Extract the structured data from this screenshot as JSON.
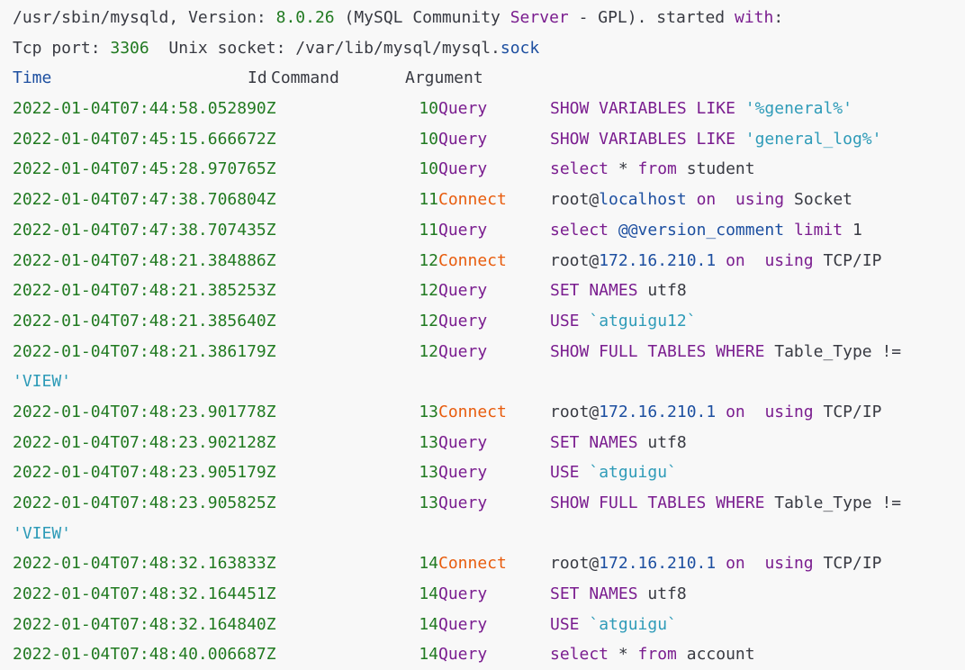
{
  "header": {
    "line1": {
      "a": "/usr/sbin/mysqld, Version: ",
      "version": "8.0.26",
      "b": " (MySQL Community ",
      "server": "Server",
      "c": " - GPL). started ",
      "with": "with",
      "d": ":"
    },
    "line2": {
      "a": "Tcp port: ",
      "port": "3306",
      "b": "  Unix socket: /var/lib/mysql/mysql.",
      "sock": "sock"
    },
    "columns": {
      "time": "Time",
      "id": "Id",
      "command": "Command",
      "argument": "Argument"
    }
  },
  "rows": [
    {
      "time": "2022-01-04T07:44:58.052890Z",
      "id": "10",
      "command": "Query",
      "arg": [
        [
          "purple",
          "SHOW VARIABLES LIKE "
        ],
        [
          "str",
          "'%general%'"
        ]
      ]
    },
    {
      "time": "2022-01-04T07:45:15.666672Z",
      "id": "10",
      "command": "Query",
      "arg": [
        [
          "purple",
          "SHOW VARIABLES LIKE "
        ],
        [
          "str",
          "'general_log%'"
        ]
      ]
    },
    {
      "time": "2022-01-04T07:45:28.970765Z",
      "id": "10",
      "command": "Query",
      "arg": [
        [
          "purple",
          "select"
        ],
        [
          "plain",
          " * "
        ],
        [
          "purple",
          "from"
        ],
        [
          "plain",
          " student"
        ]
      ]
    },
    {
      "time": "2022-01-04T07:47:38.706804Z",
      "id": "11",
      "command": "Connect",
      "arg": [
        [
          "plain",
          "root@"
        ],
        [
          "blue",
          "localhost"
        ],
        [
          "plain",
          " "
        ],
        [
          "purple",
          "on"
        ],
        [
          "plain",
          "  "
        ],
        [
          "purple",
          "using"
        ],
        [
          "plain",
          " Socket"
        ]
      ]
    },
    {
      "time": "2022-01-04T07:47:38.707435Z",
      "id": "11",
      "command": "Query",
      "arg": [
        [
          "purple",
          "select"
        ],
        [
          "plain",
          " "
        ],
        [
          "blue",
          "@@version_comment"
        ],
        [
          "plain",
          " "
        ],
        [
          "purple",
          "limit"
        ],
        [
          "plain",
          " 1"
        ]
      ]
    },
    {
      "time": "2022-01-04T07:48:21.384886Z",
      "id": "12",
      "command": "Connect",
      "arg": [
        [
          "plain",
          "root@"
        ],
        [
          "blue",
          "172.16.210.1"
        ],
        [
          "plain",
          " "
        ],
        [
          "purple",
          "on"
        ],
        [
          "plain",
          "  "
        ],
        [
          "purple",
          "using"
        ],
        [
          "plain",
          " TCP/IP"
        ]
      ]
    },
    {
      "time": "2022-01-04T07:48:21.385253Z",
      "id": "12",
      "command": "Query",
      "arg": [
        [
          "purple",
          "SET NAMES"
        ],
        [
          "plain",
          " utf8"
        ]
      ]
    },
    {
      "time": "2022-01-04T07:48:21.385640Z",
      "id": "12",
      "command": "Query",
      "arg": [
        [
          "purple",
          "USE "
        ],
        [
          "str",
          "`atguigu12`"
        ]
      ]
    },
    {
      "time": "2022-01-04T07:48:21.386179Z",
      "id": "12",
      "command": "Query",
      "arg": [
        [
          "purple",
          "SHOW FULL TABLES WHERE"
        ],
        [
          "plain",
          " Table_Type != "
        ]
      ],
      "cont": "'VIEW'"
    },
    {
      "time": "2022-01-04T07:48:23.901778Z",
      "id": "13",
      "command": "Connect",
      "arg": [
        [
          "plain",
          "root@"
        ],
        [
          "blue",
          "172.16.210.1"
        ],
        [
          "plain",
          " "
        ],
        [
          "purple",
          "on"
        ],
        [
          "plain",
          "  "
        ],
        [
          "purple",
          "using"
        ],
        [
          "plain",
          " TCP/IP"
        ]
      ]
    },
    {
      "time": "2022-01-04T07:48:23.902128Z",
      "id": "13",
      "command": "Query",
      "arg": [
        [
          "purple",
          "SET NAMES"
        ],
        [
          "plain",
          " utf8"
        ]
      ]
    },
    {
      "time": "2022-01-04T07:48:23.905179Z",
      "id": "13",
      "command": "Query",
      "arg": [
        [
          "purple",
          "USE "
        ],
        [
          "str",
          "`atguigu`"
        ]
      ]
    },
    {
      "time": "2022-01-04T07:48:23.905825Z",
      "id": "13",
      "command": "Query",
      "arg": [
        [
          "purple",
          "SHOW FULL TABLES WHERE"
        ],
        [
          "plain",
          " Table_Type != "
        ]
      ],
      "cont": "'VIEW'"
    },
    {
      "time": "2022-01-04T07:48:32.163833Z",
      "id": "14",
      "command": "Connect",
      "arg": [
        [
          "plain",
          "root@"
        ],
        [
          "blue",
          "172.16.210.1"
        ],
        [
          "plain",
          " "
        ],
        [
          "purple",
          "on"
        ],
        [
          "plain",
          "  "
        ],
        [
          "purple",
          "using"
        ],
        [
          "plain",
          " TCP/IP"
        ]
      ]
    },
    {
      "time": "2022-01-04T07:48:32.164451Z",
      "id": "14",
      "command": "Query",
      "arg": [
        [
          "purple",
          "SET NAMES"
        ],
        [
          "plain",
          " utf8"
        ]
      ]
    },
    {
      "time": "2022-01-04T07:48:32.164840Z",
      "id": "14",
      "command": "Query",
      "arg": [
        [
          "purple",
          "USE "
        ],
        [
          "str",
          "`atguigu`"
        ]
      ]
    },
    {
      "time": "2022-01-04T07:48:40.006687Z",
      "id": "14",
      "command": "Query",
      "arg": [
        [
          "purple",
          "select"
        ],
        [
          "plain",
          " * "
        ],
        [
          "purple",
          "from"
        ],
        [
          "plain",
          " account"
        ]
      ]
    }
  ],
  "colors": {
    "background": "#f8f8f8",
    "timestamp": "#217a21",
    "keyword": "#7a1d8f",
    "connect": "#e85c0d",
    "identifier": "#1d4fa0",
    "string": "#2e9bb8"
  }
}
